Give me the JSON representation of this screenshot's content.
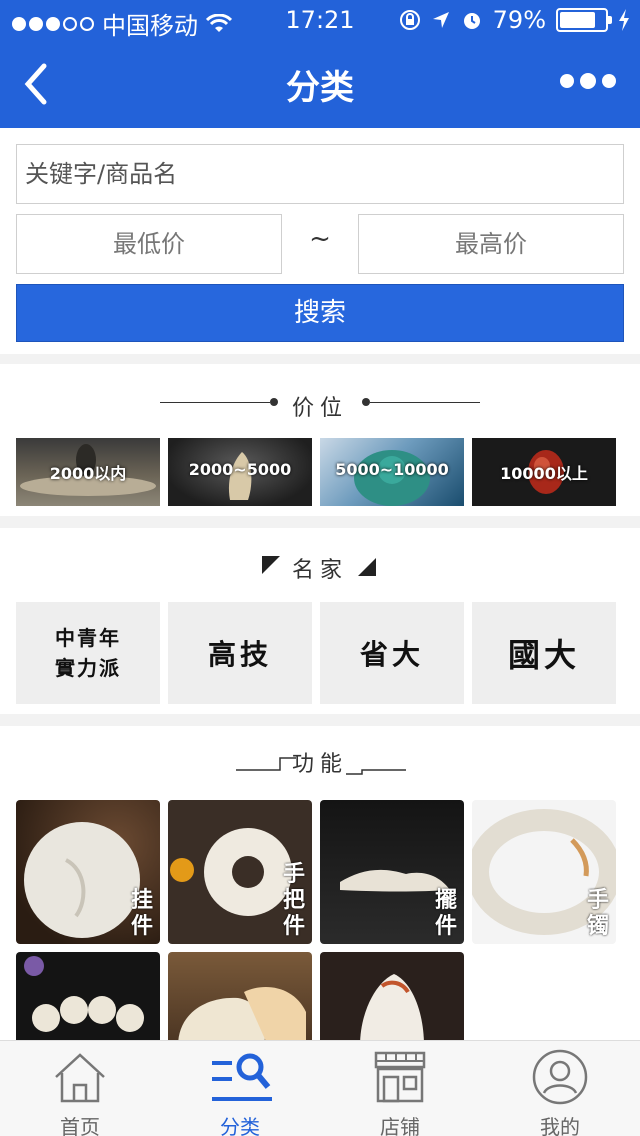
{
  "status": {
    "carrier": "中国移动",
    "time": "17:21",
    "battery": "79%",
    "battery_level": 0.79
  },
  "nav": {
    "title": "分类"
  },
  "search": {
    "keyword_placeholder": "关键字/商品名",
    "min_price_placeholder": "最低价",
    "tilde": "~",
    "max_price_placeholder": "最高价",
    "button": "搜索"
  },
  "price_section": {
    "title": "价位",
    "items": [
      "2000以内",
      "2000~5000",
      "5000~10000",
      "10000以上"
    ]
  },
  "master_section": {
    "title": "名家",
    "items": [
      {
        "line1": "中青年",
        "line2": "實力派"
      },
      {
        "line1": "高技",
        "line2": ""
      },
      {
        "line1": "省大",
        "line2": ""
      },
      {
        "line1": "國大",
        "line2": ""
      }
    ]
  },
  "function_section": {
    "title": "功能",
    "items": [
      {
        "tag": "挂件"
      },
      {
        "tag": "手把件"
      },
      {
        "tag": "擺件"
      },
      {
        "tag": "手镯"
      },
      {
        "tag": ""
      },
      {
        "tag": ""
      },
      {
        "tag": ""
      }
    ]
  },
  "tabs": [
    {
      "label": "首页",
      "icon": "home-icon"
    },
    {
      "label": "分类",
      "icon": "category-search-icon",
      "active": true
    },
    {
      "label": "店铺",
      "icon": "store-icon"
    },
    {
      "label": "我的",
      "icon": "user-icon"
    }
  ],
  "colors": {
    "primary": "#2362d9",
    "button": "#2767dd"
  }
}
